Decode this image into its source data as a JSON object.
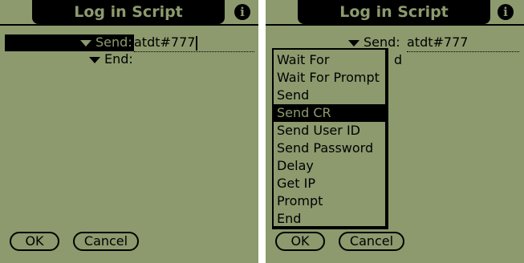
{
  "colors": {
    "screen_bg": "#8c9a6e",
    "ink": "#000000"
  },
  "left": {
    "title": "Log in Script",
    "info_icon": "i",
    "rows": [
      {
        "label": "Send:",
        "value": "atdt#777"
      },
      {
        "label": "End:"
      }
    ],
    "buttons": {
      "ok": "OK",
      "cancel": "Cancel"
    }
  },
  "right": {
    "title": "Log in Script",
    "info_icon": "i",
    "rows": [
      {
        "label": "Send:",
        "value": "atdt#777"
      }
    ],
    "second_row_partial": "d",
    "buttons": {
      "ok": "OK",
      "cancel": "Cancel"
    },
    "menu": {
      "items": [
        "Wait For",
        "Wait For Prompt",
        "Send",
        "Send CR",
        "Send User ID",
        "Send Password",
        "Delay",
        "Get IP",
        "Prompt",
        "End"
      ],
      "selected": "Send CR"
    }
  },
  "icons": {
    "info": "info-icon",
    "dropdown_arrow": "triangle-down-icon"
  }
}
